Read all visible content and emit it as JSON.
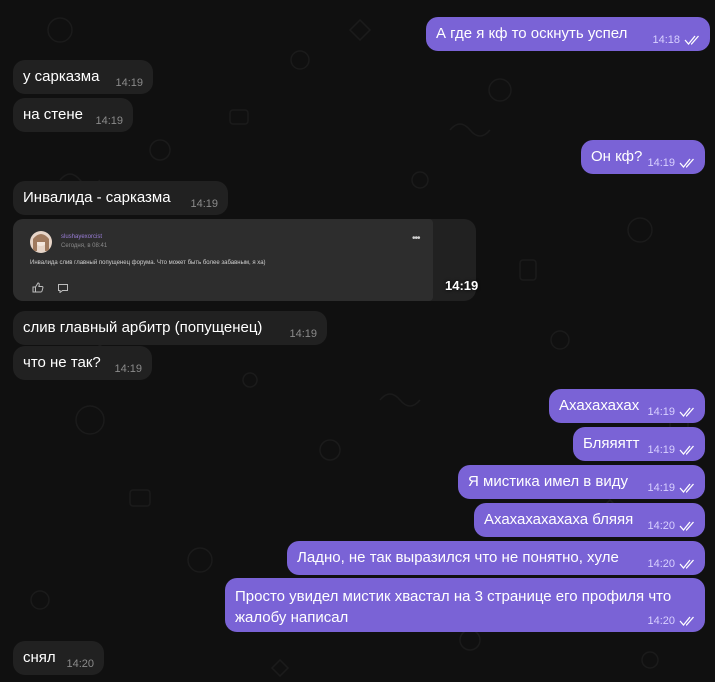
{
  "colors": {
    "background": "#101010",
    "incoming_bubble": "#212121",
    "outgoing_bubble": "#7a63d6",
    "read_check": "#ffffff"
  },
  "messages": [
    {
      "text": "А где я кф то оскнуть успел",
      "time": "14:18",
      "direction": "out",
      "status": "read"
    },
    {
      "text": "у сарказма",
      "time": "14:19",
      "direction": "in"
    },
    {
      "text": "на стене",
      "time": "14:19",
      "direction": "in"
    },
    {
      "text": "Он кф?",
      "time": "14:19",
      "direction": "out",
      "status": "read"
    },
    {
      "text": "Инвалида - сарказма",
      "time": "14:19",
      "direction": "in"
    },
    {
      "text": "слив главный арбитр (попущенец)",
      "time": "14:19",
      "direction": "in"
    },
    {
      "text": "что не так?",
      "time": "14:19",
      "direction": "in"
    },
    {
      "text": "Ахахахахах",
      "time": "14:19",
      "direction": "out",
      "status": "read"
    },
    {
      "text": "Бляяятт",
      "time": "14:19",
      "direction": "out",
      "status": "read"
    },
    {
      "text": "Я мистика имел в виду",
      "time": "14:19",
      "direction": "out",
      "status": "read"
    },
    {
      "text": "Ахахахахахаха бляяя",
      "time": "14:20",
      "direction": "out",
      "status": "read"
    },
    {
      "text": "Ладно, не так выразился что не понятно, хуле",
      "time": "14:20",
      "direction": "out",
      "status": "read"
    },
    {
      "text": "Просто увидел мистик хвастал на 3 странице его профиля что жалобу написал",
      "time": "14:20",
      "direction": "out",
      "status": "read"
    },
    {
      "text": "снял",
      "time": "14:20",
      "direction": "in"
    }
  ],
  "embed": {
    "author": "slushayexorcist",
    "date": "Сегодня, в 08:41",
    "text": "Инвалида слив главный попущенец форума. Что может быть более забавным, я ха)",
    "time": "14:19",
    "more_icon": "more-dots-icon",
    "like_icon": "thumbs-up-icon",
    "comment_icon": "comment-icon"
  }
}
